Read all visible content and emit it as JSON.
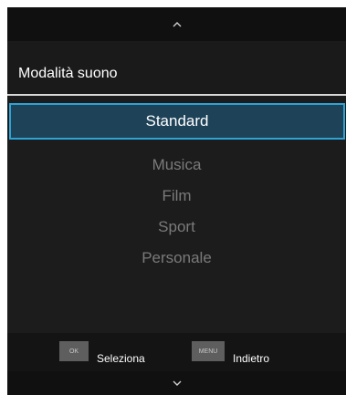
{
  "menu": {
    "title": "Modalità suono",
    "selected": "Standard",
    "options": [
      "Musica",
      "Film",
      "Sport",
      "Personale"
    ]
  },
  "footer": {
    "ok_key": "OK",
    "ok_label": "Seleziona",
    "menu_key": "MENU",
    "menu_label": "Indietro"
  },
  "icons": {
    "up": "chevron-up-icon",
    "down": "chevron-down-icon"
  },
  "colors": {
    "background": "#1a1a1a",
    "selection_fill": "#1e4258",
    "selection_border": "#2ea4d6",
    "inactive_text": "#7a7a7a",
    "key_fill": "#5e5e5e"
  }
}
